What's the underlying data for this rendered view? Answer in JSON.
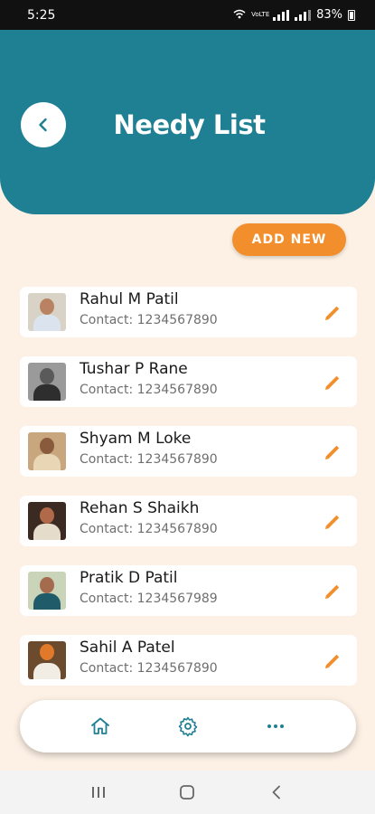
{
  "status_bar": {
    "time": "5:25",
    "network": "VoLTE",
    "battery": "83%"
  },
  "header": {
    "title": "Needy List",
    "back_icon": "chevron-left-icon"
  },
  "add_button": {
    "label": "ADD NEW"
  },
  "needy_list": [
    {
      "name": "Rahul M Patil",
      "contact": "Contact: 1234567890"
    },
    {
      "name": "Tushar P Rane",
      "contact": "Contact: 1234567890"
    },
    {
      "name": "Shyam M Loke",
      "contact": "Contact: 1234567890"
    },
    {
      "name": "Rehan S Shaikh",
      "contact": "Contact: 1234567890"
    },
    {
      "name": "Pratik D Patil",
      "contact": "Contact: 1234567989"
    },
    {
      "name": "Sahil A Patel",
      "contact": "Contact: 1234567890"
    }
  ],
  "bottom_nav": {
    "items": [
      "home-icon",
      "settings-icon",
      "more-icon"
    ]
  },
  "colors": {
    "primary": "#1f7f93",
    "accent": "#f28f2c",
    "background": "#fdf1e5"
  }
}
